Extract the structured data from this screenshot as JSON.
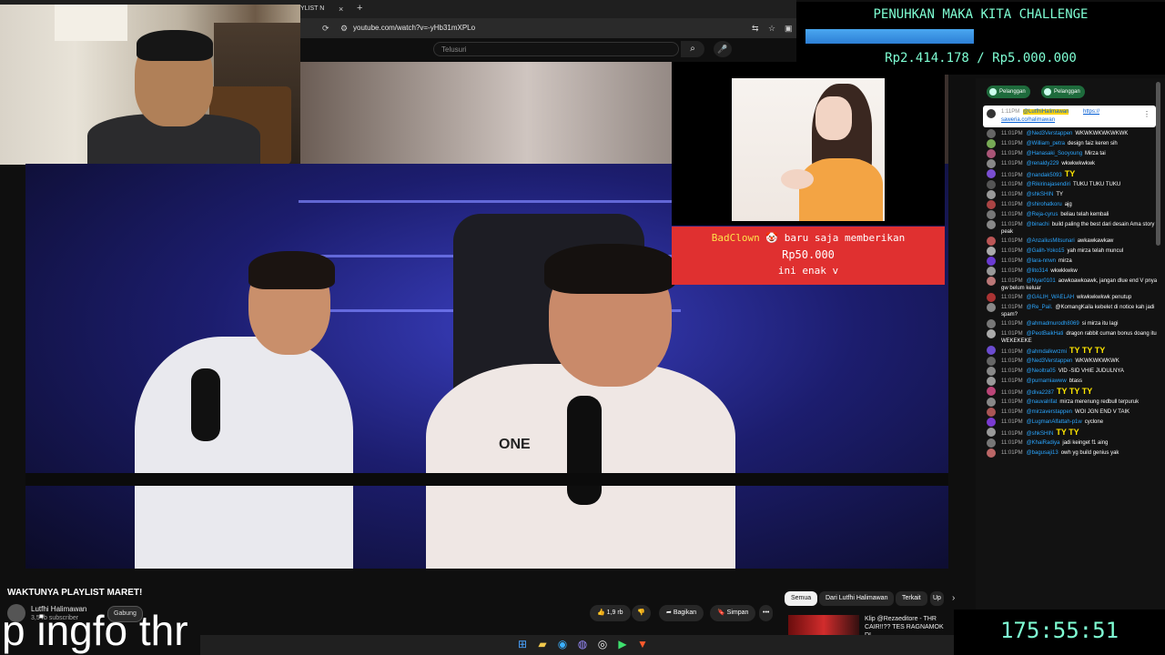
{
  "browser": {
    "tab_title": "YLIST N",
    "tab_close": "×",
    "tab_new": "+",
    "url": "youtube.com/watch?v=-yHb31mXPLo",
    "search_placeholder": "Telusuri"
  },
  "goal": {
    "title": "PENUHKAN MAKA KITA CHALLENGE",
    "amount": "Rp2.414.178 / Rp5.000.000",
    "progress": 0.48,
    "color": "#7fffd4"
  },
  "donation": {
    "name": "BadClown",
    "text": "baru saja memberikan",
    "amount": "Rp50.000",
    "message": "ini enak v",
    "bg_color": "#e03030"
  },
  "chat": {
    "chips": [
      "Pelanggan",
      "Pelanggan"
    ],
    "pinned": {
      "time": "1:11PM",
      "user": "@LutfhiHalimawan",
      "link1": "https://",
      "link2": "saweria.co/halimawan"
    },
    "messages": [
      {
        "time": "11:01PM",
        "user": "@Ned3Verstappen",
        "text": "WKWKWKWKWKWK",
        "emote": "",
        "color": "#666"
      },
      {
        "time": "11:01PM",
        "user": "@William_petra",
        "text": "design faiz keren sih",
        "emote": "",
        "color": "#7a5"
      },
      {
        "time": "11:01PM",
        "user": "@Hanasaki_Sooyoung",
        "text": "Mirza tai",
        "emote": "",
        "color": "#a57"
      },
      {
        "time": "11:01PM",
        "user": "@renaldy229",
        "text": "wkwkwkwkwk",
        "emote": "",
        "color": "#888"
      },
      {
        "time": "11:01PM",
        "user": "@nandak5093",
        "text": "",
        "emote": "TY",
        "color": "#7a4ed1"
      },
      {
        "time": "11:01PM",
        "user": "@Rikirinajasendiri",
        "text": "TUKU TUKU TUKU",
        "emote": "",
        "color": "#555"
      },
      {
        "time": "11:01PM",
        "user": "@shkSHIN",
        "text": "TY",
        "emote": "",
        "color": "#999"
      },
      {
        "time": "11:01PM",
        "user": "@shirohatkoru",
        "text": "ajg",
        "emote": "",
        "color": "#a44"
      },
      {
        "time": "11:01PM",
        "user": "@Reja-cyrus",
        "text": "beliau telah kembali",
        "emote": "",
        "color": "#777"
      },
      {
        "time": "11:01PM",
        "user": "@binachi",
        "text": "build paling the best dari desain Ama story peak",
        "emote": "",
        "color": "#888"
      },
      {
        "time": "11:01PM",
        "user": "@AnzaliusMitsunari",
        "text": "awkawkawkaw",
        "emote": "",
        "color": "#b55"
      },
      {
        "time": "11:01PM",
        "user": "@Galih-Yoko15",
        "text": "yah mirza telah muncul",
        "emote": "",
        "color": "#aaa"
      },
      {
        "time": "11:01PM",
        "user": "@lara-nnwn",
        "text": "mirza",
        "emote": "",
        "color": "#6a3ad1"
      },
      {
        "time": "11:01PM",
        "user": "@lito314",
        "text": "wkwkkwkw",
        "emote": "",
        "color": "#999"
      },
      {
        "time": "11:01PM",
        "user": "@Nyar0101",
        "text": "aowkoawkoawk, jangan dlue end V pnya gw belum keluar",
        "emote": "",
        "color": "#b77"
      },
      {
        "time": "11:01PM",
        "user": "@GALIH_WAELAH",
        "text": "wkwkwkwkwk penutup",
        "emote": "",
        "color": "#a33"
      },
      {
        "time": "11:01PM",
        "user": "@Re_Pail.",
        "text": "@KomangKaila kebelet di notice kah jadi spam?",
        "emote": "",
        "color": "#888"
      },
      {
        "time": "11:01PM",
        "user": "@ahmadmurodh8069",
        "text": "si mirza itu lagi",
        "emote": "",
        "color": "#777"
      },
      {
        "time": "11:01PM",
        "user": "@PeotBaikHati",
        "text": "dragon rabbit cuman bonus doang itu WEKEKEKE",
        "emote": "",
        "color": "#aaa"
      },
      {
        "time": "11:01PM",
        "user": "@ahmdalkwrzmi",
        "text": "",
        "emote": "TY TY TY",
        "color": "#6b4bd0"
      },
      {
        "time": "11:01PM",
        "user": "@Ned3Verstappen",
        "text": "WKWKWKWKWK",
        "emote": "",
        "color": "#666"
      },
      {
        "time": "11:01PM",
        "user": "@Neoltra05",
        "text": "VID -SID VHIE JUDULNYA",
        "emote": "",
        "color": "#888"
      },
      {
        "time": "11:01PM",
        "user": "@purnamiawww",
        "text": "btass",
        "emote": "",
        "color": "#999"
      },
      {
        "time": "11:01PM",
        "user": "@diva2287",
        "text": "",
        "emote": "TY TY TY",
        "color": "#b47"
      },
      {
        "time": "11:01PM",
        "user": "@nauvalrifat",
        "text": "mirza merenung redbull terpuruk",
        "emote": "",
        "color": "#888"
      },
      {
        "time": "11:01PM",
        "user": "@mirzaverstappen",
        "text": "WOI JGN END V TAIK",
        "emote": "",
        "color": "#a55"
      },
      {
        "time": "11:01PM",
        "user": "@LugmanAlfattah-p1w",
        "text": "cyclone",
        "emote": "",
        "color": "#7a3ad1"
      },
      {
        "time": "11:01PM",
        "user": "@shkSHIN",
        "text": "",
        "emote": "TY TY",
        "color": "#999"
      },
      {
        "time": "11:01PM",
        "user": "@KhaiRadiya",
        "text": "jadi keinget f1 aing",
        "emote": "",
        "color": "#777"
      },
      {
        "time": "11:01PM",
        "user": "@bagusaji13",
        "text": "owh yg build genius yak",
        "emote": "",
        "color": "#b66"
      }
    ]
  },
  "timer": "175:55:51",
  "video": {
    "title": "WAKTUNYA PLAYLIST MARET!",
    "channel": "Lutfhi Halimawan",
    "subs": "3,5 rb subscriber",
    "join": "Gabung",
    "likes": "1,9 rb",
    "share": "Bagikan",
    "save": "Simpan",
    "more": "•••",
    "shirt_text": "ONE"
  },
  "subtitle": "p ingfo thr",
  "recommend": {
    "filters": [
      "Semua",
      "Dari Lutfhi Halimawan",
      "Terkait",
      "Up"
    ],
    "item_title": "Klip @Rezaeditore - THR CAIR!!?? TES RAGNAMOK DI ..."
  },
  "icons": {
    "search": "search-icon",
    "mic": "mic-icon",
    "like": "thumbs-up-icon",
    "dislike": "thumbs-down-icon",
    "share": "share-icon",
    "save": "bookmark-icon"
  }
}
